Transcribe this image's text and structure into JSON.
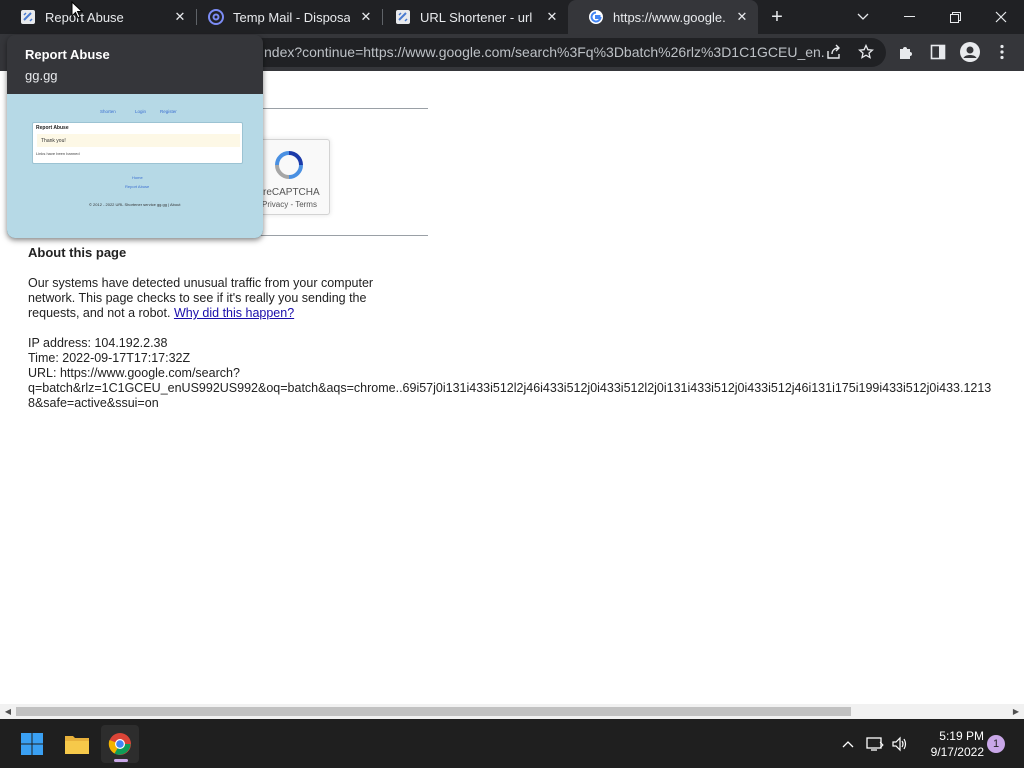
{
  "browser": {
    "tabs": [
      {
        "title": "Report Abuse",
        "favicon": "url-shortener-favicon",
        "active": false
      },
      {
        "title": "Temp Mail - Disposable",
        "favicon": "at-sign-favicon",
        "active": false
      },
      {
        "title": "URL Shortener - url sho",
        "favicon": "url-shortener-favicon",
        "active": false
      },
      {
        "title": "https://www.google.co",
        "favicon": "google-favicon",
        "active": true
      }
    ],
    "address_bar": {
      "text": "ndex?continue=https://www.google.com/search%3Fq%3Dbatch%26rlz%3D1C1GCEU_en..."
    }
  },
  "hover_card": {
    "title": "Report Abuse",
    "domain": "gg.gg",
    "preview": {
      "nav": [
        "Shorten",
        "Login",
        "Register"
      ],
      "box_heading": "Report Abuse",
      "thanks_text": "Thank you!",
      "line_text": "Links have been banned",
      "links": [
        "Home",
        "Report Abuse"
      ],
      "footer": "© 2012 - 2022 URL Shortener service gg.gg | About"
    }
  },
  "captcha": {
    "label": "reCAPTCHA",
    "sub": "Privacy - Terms"
  },
  "page": {
    "about_heading": "About this page",
    "paragraph_lines": [
      "Our systems have detected unusual traffic from your computer",
      "network. This page checks to see if it's really you sending the",
      "requests, and not a robot. "
    ],
    "why_link": "Why did this happen?",
    "ip_line": "IP address: 104.192.2.38",
    "time_line": "Time: 2022-09-17T17:17:32Z",
    "url_line1": "URL: https://www.google.com/search?",
    "url_line2": "q=batch&rlz=1C1GCEU_enUS992US992&oq=batch&aqs=chrome..69i57j0i131i433i512l2j46i433i512j0i433i512l2j0i131i433i512j0i433i512j46i131i175i199i433i512j0i433.1213",
    "url_line3": "8&safe=active&ssui=on"
  },
  "taskbar": {
    "time": "5:19 PM",
    "date": "9/17/2022",
    "notification_count": "1",
    "apps": [
      "windows-start-icon",
      "file-explorer-icon",
      "chrome-icon"
    ]
  }
}
